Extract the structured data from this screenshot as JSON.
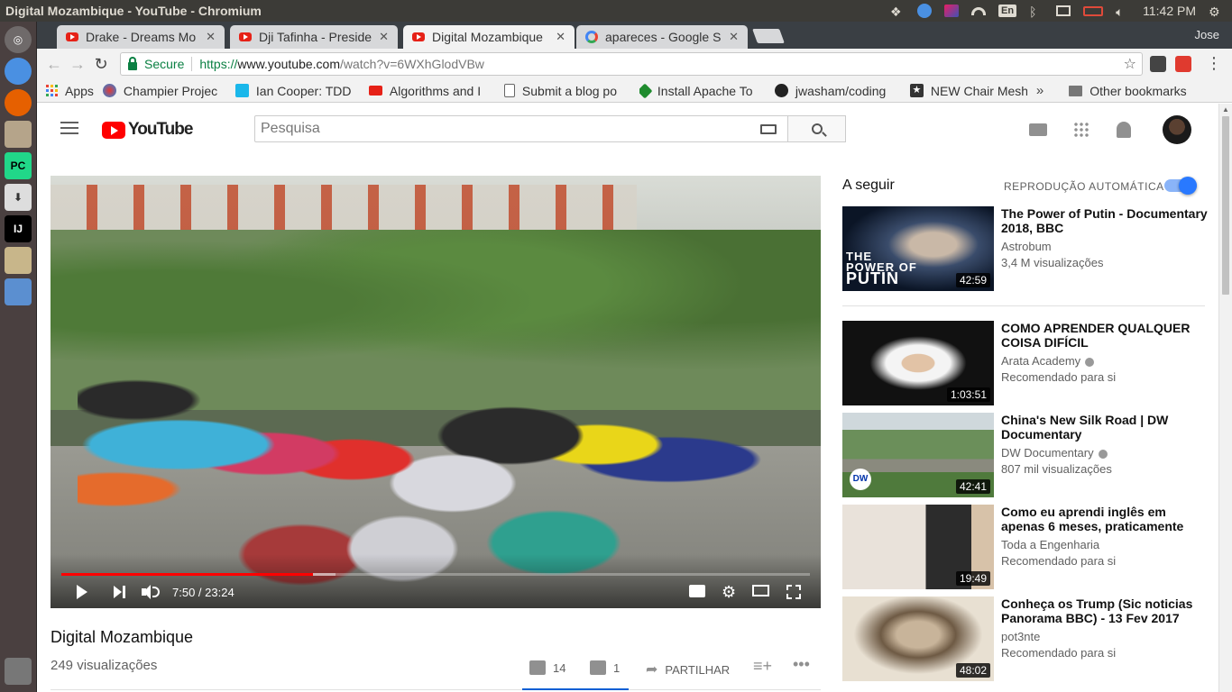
{
  "os": {
    "window_title": "Digital Mozambique - YouTube - Chromium",
    "lang": "En",
    "time": "11:42 PM"
  },
  "browser": {
    "tabs": [
      {
        "label": "Drake - Dreams Mo",
        "icon": "youtube-icon"
      },
      {
        "label": "Dji Tafinha - Preside",
        "icon": "youtube-icon"
      },
      {
        "label": "Digital Mozambique",
        "icon": "youtube-icon",
        "active": true
      },
      {
        "label": "apareces - Google S",
        "icon": "google-icon"
      }
    ],
    "user": "Jose",
    "secure_label": "Secure",
    "url_scheme": "https://",
    "url_host": "www.youtube.com",
    "url_path": "/watch?v=6WXhGlodVBw",
    "bookmarks": [
      {
        "label": "Apps"
      },
      {
        "label": "Champier Projec"
      },
      {
        "label": "Ian Cooper: TDD"
      },
      {
        "label": "Algorithms and I"
      },
      {
        "label": "Submit a blog po"
      },
      {
        "label": "Install Apache To"
      },
      {
        "label": "jwasham/coding"
      },
      {
        "label": "NEW Chair Mesh"
      }
    ],
    "bookmarks_more": "»",
    "other_bookmarks": "Other bookmarks"
  },
  "youtube": {
    "logo_text": "YouTube",
    "search_placeholder": "Pesquisa",
    "video": {
      "title": "Digital Mozambique",
      "views": "249 visualizações",
      "time": "7:50 / 23:24",
      "progress": 0.336,
      "buffered": 0.33,
      "likes": "14",
      "dislikes": "1",
      "share": "PARTILHAR"
    },
    "up_next": "A seguir",
    "autoplay": "REPRODUÇÃO AUTOMÁTICA",
    "autoplay_on": true,
    "recommendations": [
      {
        "title": "The Power of Putin - Documentary 2018, BBC",
        "channel": "Astrobum",
        "meta": "3,4 M visualizações",
        "duration": "42:59",
        "verified": false
      },
      {
        "title": "COMO APRENDER QUALQUER COISA DIFÍCIL",
        "channel": "Arata Academy",
        "meta": "Recomendado para si",
        "duration": "1:03:51",
        "verified": true
      },
      {
        "title": "China's New Silk Road | DW Documentary",
        "channel": "DW Documentary",
        "meta": "807 mil visualizações",
        "duration": "42:41",
        "verified": true
      },
      {
        "title": "Como eu aprendi inglês em apenas 6 meses, praticamente",
        "channel": "Toda a Engenharia",
        "meta": "Recomendado para si",
        "duration": "19:49",
        "verified": false
      },
      {
        "title": "Conheça os Trump (Sic noticias Panorama BBC) - 13 Fev 2017",
        "channel": "pot3nte",
        "meta": "Recomendado para si",
        "duration": "48:02",
        "verified": false
      }
    ]
  },
  "colors": {
    "accent": "#ff0000",
    "link_blue": "#065fd4",
    "secure_green": "#0b8043"
  }
}
